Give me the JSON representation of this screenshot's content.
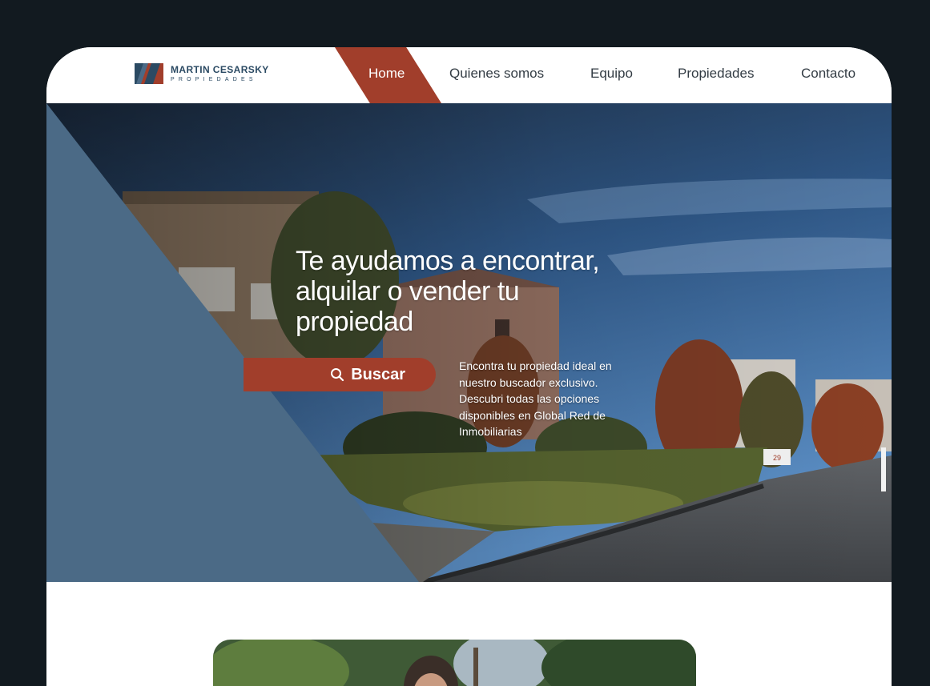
{
  "brand": {
    "name": "MARTIN CESARSKY",
    "subtitle": "PROPIEDADES",
    "colors": {
      "navy": "#2b4a63",
      "rust": "#a13e2b",
      "slate": "#4b6a86"
    }
  },
  "nav": {
    "items": [
      {
        "label": "Home",
        "active": true
      },
      {
        "label": "Quienes somos",
        "active": false
      },
      {
        "label": "Equipo",
        "active": false
      },
      {
        "label": "Propiedades",
        "active": false
      },
      {
        "label": "Contacto",
        "active": false
      }
    ]
  },
  "hero": {
    "title": "Te ayudamos a encontrar, alquilar o vender tu propiedad",
    "search_label": "Buscar",
    "search_icon": "search-icon",
    "description": "Encontra tu propiedad ideal en nuestro buscador exclusivo. Descubri todas las opciones disponibles en Global Red de Inmobiliarias",
    "sign_text": "29"
  }
}
